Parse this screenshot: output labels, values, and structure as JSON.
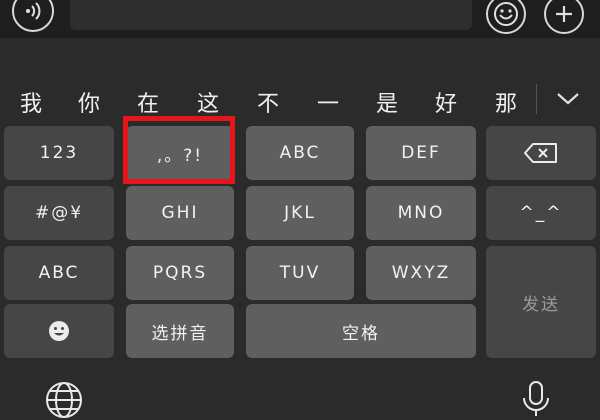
{
  "top_bar": {
    "voice_icon": "voice-wave-icon",
    "emoji_icon": "smiley-icon",
    "plus_icon": "plus-icon"
  },
  "candidates": [
    "我",
    "你",
    "在",
    "这",
    "不",
    "一",
    "是",
    "好",
    "那"
  ],
  "candidate_expand_icon": "chevron-down-icon",
  "keys": {
    "row1": [
      "123",
      ",。?!",
      "ABC",
      "DEF"
    ],
    "backspace_icon": "backspace-icon",
    "row2": [
      "#@¥",
      "GHI",
      "JKL",
      "MNO",
      "^_^"
    ],
    "row3": [
      "ABC",
      "PQRS",
      "TUV",
      "WXYZ"
    ],
    "send": "发送",
    "row4_emoji_icon": "smiley-icon",
    "pinyin": "选拼音",
    "space": "空格"
  },
  "bottom": {
    "globe_icon": "globe-icon",
    "mic_icon": "microphone-icon"
  },
  "colors": {
    "background": "#2b2b2b",
    "key_dark": "#464646",
    "key_light": "#5f5f5f",
    "highlight": "#e8141c"
  }
}
